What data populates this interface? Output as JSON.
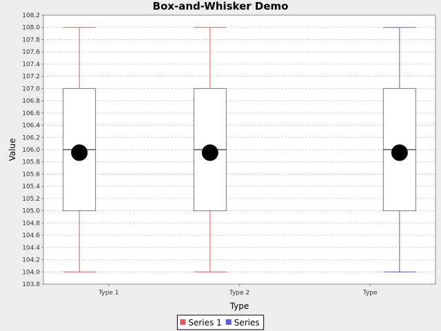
{
  "chart_data": {
    "type": "box",
    "title": "Box-and-Whisker Demo",
    "xlabel": "Type",
    "ylabel": "Value",
    "ylim": [
      103.8,
      108.2
    ],
    "ytick_step": 0.2,
    "grid": true,
    "categories": [
      "Type 1",
      "Type 2",
      "Type"
    ],
    "series": [
      {
        "name": "Series 1",
        "color": "#e05a5a",
        "boxes": [
          {
            "category": "Type 1",
            "whisker_low": 104.0,
            "q1": 105.0,
            "median": 106.0,
            "q3": 107.0,
            "whisker_high": 108.0,
            "mean": 105.95
          },
          {
            "category": "Type 2",
            "whisker_low": 104.0,
            "q1": 105.0,
            "median": 106.0,
            "q3": 107.0,
            "whisker_high": 108.0,
            "mean": 105.95
          }
        ]
      },
      {
        "name": "Series",
        "color": "#5a5ae0",
        "boxes": [
          {
            "category": "Type",
            "whisker_low": 104.0,
            "q1": 105.0,
            "median": 106.0,
            "q3": 107.0,
            "whisker_high": 108.0,
            "mean": 105.95
          }
        ]
      }
    ],
    "legend_position": "bottom"
  }
}
